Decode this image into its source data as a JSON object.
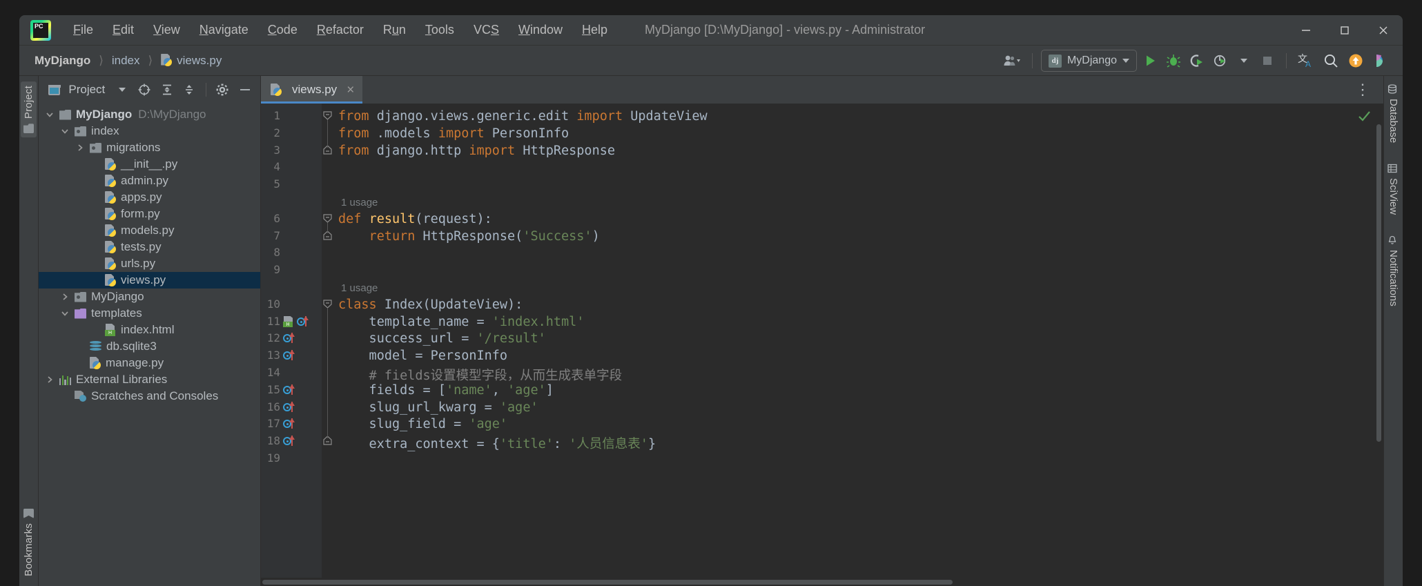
{
  "window": {
    "title": "MyDjango [D:\\MyDjango] - views.py - Administrator",
    "minimize": "minimize-icon",
    "maximize": "maximize-icon",
    "close": "close-icon"
  },
  "menu": [
    {
      "label": "File",
      "mnemonic": "F"
    },
    {
      "label": "Edit",
      "mnemonic": "E"
    },
    {
      "label": "View",
      "mnemonic": "V"
    },
    {
      "label": "Navigate",
      "mnemonic": "N"
    },
    {
      "label": "Code",
      "mnemonic": "C"
    },
    {
      "label": "Refactor",
      "mnemonic": "R"
    },
    {
      "label": "Run",
      "mnemonic": "u"
    },
    {
      "label": "Tools",
      "mnemonic": "T"
    },
    {
      "label": "VCS",
      "mnemonic": "S"
    },
    {
      "label": "Window",
      "mnemonic": "W"
    },
    {
      "label": "Help",
      "mnemonic": "H"
    }
  ],
  "breadcrumbs": [
    {
      "label": "MyDjango",
      "bold": true,
      "icon": ""
    },
    {
      "label": "index",
      "bold": false,
      "icon": ""
    },
    {
      "label": "views.py",
      "bold": false,
      "icon": "python-file-icon"
    }
  ],
  "toolbar": {
    "user_icon": "user-accounts-icon",
    "run_config": {
      "label": "MyDjango",
      "badge": "dj"
    },
    "run_icon": "run-icon",
    "debug_icon": "debug-icon",
    "run_coverage_icon": "run-with-coverage-icon",
    "profile_icon": "profiler-icon",
    "stop_icon": "stop-icon",
    "translate_icon": "translate-icon",
    "search_icon": "search-everywhere-icon",
    "update_icon": "update-project-icon",
    "ide_icon": "ide-feature-icon"
  },
  "left_tabs": [
    {
      "label": "Project",
      "icon": "project-folder-icon",
      "active": true
    },
    {
      "label": "Bookmarks",
      "icon": "bookmarks-icon",
      "active": false
    }
  ],
  "project_panel": {
    "title": "Project",
    "title_icon": "project-view-icon",
    "buttons": [
      {
        "name": "select-opened-file-icon"
      },
      {
        "name": "expand-all-icon"
      },
      {
        "name": "collapse-all-icon"
      },
      {
        "name": "settings-gear-icon"
      },
      {
        "name": "hide-panel-icon"
      }
    ],
    "tree": [
      {
        "label": "MyDjango",
        "hint": "D:\\MyDjango",
        "indent": 0,
        "arrow": "down",
        "icon": "folder",
        "bold": true,
        "selected": false
      },
      {
        "label": "index",
        "hint": "",
        "indent": 1,
        "arrow": "down",
        "icon": "package",
        "bold": false,
        "selected": false
      },
      {
        "label": "migrations",
        "hint": "",
        "indent": 2,
        "arrow": "right",
        "icon": "package",
        "bold": false,
        "selected": false
      },
      {
        "label": "__init__.py",
        "hint": "",
        "indent": 3,
        "arrow": "none",
        "icon": "python",
        "bold": false,
        "selected": false
      },
      {
        "label": "admin.py",
        "hint": "",
        "indent": 3,
        "arrow": "none",
        "icon": "python",
        "bold": false,
        "selected": false
      },
      {
        "label": "apps.py",
        "hint": "",
        "indent": 3,
        "arrow": "none",
        "icon": "python",
        "bold": false,
        "selected": false
      },
      {
        "label": "form.py",
        "hint": "",
        "indent": 3,
        "arrow": "none",
        "icon": "python",
        "bold": false,
        "selected": false
      },
      {
        "label": "models.py",
        "hint": "",
        "indent": 3,
        "arrow": "none",
        "icon": "python",
        "bold": false,
        "selected": false
      },
      {
        "label": "tests.py",
        "hint": "",
        "indent": 3,
        "arrow": "none",
        "icon": "python",
        "bold": false,
        "selected": false
      },
      {
        "label": "urls.py",
        "hint": "",
        "indent": 3,
        "arrow": "none",
        "icon": "python",
        "bold": false,
        "selected": false
      },
      {
        "label": "views.py",
        "hint": "",
        "indent": 3,
        "arrow": "none",
        "icon": "python",
        "bold": false,
        "selected": true
      },
      {
        "label": "MyDjango",
        "hint": "",
        "indent": 1,
        "arrow": "right",
        "icon": "package",
        "bold": false,
        "selected": false
      },
      {
        "label": "templates",
        "hint": "",
        "indent": 1,
        "arrow": "down",
        "icon": "folder-purple",
        "bold": false,
        "selected": false
      },
      {
        "label": "index.html",
        "hint": "",
        "indent": 3,
        "arrow": "none",
        "icon": "html",
        "bold": false,
        "selected": false
      },
      {
        "label": "db.sqlite3",
        "hint": "",
        "indent": 2,
        "arrow": "none",
        "icon": "database",
        "bold": false,
        "selected": false
      },
      {
        "label": "manage.py",
        "hint": "",
        "indent": 2,
        "arrow": "none",
        "icon": "python",
        "bold": false,
        "selected": false
      },
      {
        "label": "External Libraries",
        "hint": "",
        "indent": 0,
        "arrow": "right",
        "icon": "libraries",
        "bold": false,
        "selected": false
      },
      {
        "label": "Scratches and Consoles",
        "hint": "",
        "indent": 1,
        "arrow": "none",
        "icon": "scratches",
        "bold": false,
        "selected": false
      }
    ]
  },
  "editor": {
    "tab": {
      "label": "views.py",
      "icon": "python-file-icon",
      "close": "close-tab-icon"
    },
    "more_menu": "more-options-icon",
    "inspection_status": "no-problems-check-icon",
    "lines": [
      {
        "num": "1",
        "inlay": "",
        "gutter": [],
        "fold": "fold-start",
        "tokens": [
          {
            "t": "from ",
            "c": "k"
          },
          {
            "t": "django.views.generic.edit ",
            "c": "pl"
          },
          {
            "t": "import ",
            "c": "k"
          },
          {
            "t": "UpdateView",
            "c": "cls"
          }
        ]
      },
      {
        "num": "2",
        "inlay": "",
        "gutter": [],
        "fold": "",
        "tokens": [
          {
            "t": "from ",
            "c": "k"
          },
          {
            "t": ".models ",
            "c": "pl"
          },
          {
            "t": "import ",
            "c": "k"
          },
          {
            "t": "PersonInfo",
            "c": "cls"
          }
        ]
      },
      {
        "num": "3",
        "inlay": "",
        "gutter": [],
        "fold": "fold-end",
        "tokens": [
          {
            "t": "from ",
            "c": "k"
          },
          {
            "t": "django.http ",
            "c": "pl"
          },
          {
            "t": "import ",
            "c": "k"
          },
          {
            "t": "HttpResponse",
            "c": "cls"
          }
        ]
      },
      {
        "num": "4",
        "inlay": "",
        "gutter": [],
        "fold": "",
        "tokens": []
      },
      {
        "num": "5",
        "inlay": "",
        "gutter": [],
        "fold": "",
        "tokens": []
      },
      {
        "num": "",
        "inlay": "1 usage",
        "gutter": [],
        "fold": "",
        "tokens": []
      },
      {
        "num": "6",
        "inlay": "",
        "gutter": [],
        "fold": "fold-start",
        "tokens": [
          {
            "t": "def ",
            "c": "k"
          },
          {
            "t": "result",
            "c": "fn"
          },
          {
            "t": "(request):",
            "c": "pl"
          }
        ]
      },
      {
        "num": "7",
        "inlay": "",
        "gutter": [],
        "fold": "fold-end",
        "tokens": [
          {
            "t": "    return ",
            "c": "k"
          },
          {
            "t": "HttpResponse(",
            "c": "cls"
          },
          {
            "t": "'Success'",
            "c": "s"
          },
          {
            "t": ")",
            "c": "pl"
          }
        ]
      },
      {
        "num": "8",
        "inlay": "",
        "gutter": [],
        "fold": "",
        "tokens": []
      },
      {
        "num": "9",
        "inlay": "",
        "gutter": [],
        "fold": "",
        "tokens": []
      },
      {
        "num": "",
        "inlay": "1 usage",
        "gutter": [],
        "fold": "",
        "tokens": []
      },
      {
        "num": "10",
        "inlay": "",
        "gutter": [],
        "fold": "fold-start",
        "tokens": [
          {
            "t": "class ",
            "c": "k"
          },
          {
            "t": "Index(UpdateView):",
            "c": "cls"
          }
        ]
      },
      {
        "num": "11",
        "inlay": "",
        "gutter": [
          "html-file-icon",
          "overridden-member-icon"
        ],
        "fold": "",
        "tokens": [
          {
            "t": "    template_name = ",
            "c": "pl"
          },
          {
            "t": "'index.html'",
            "c": "s"
          }
        ]
      },
      {
        "num": "12",
        "inlay": "",
        "gutter": [
          "overridden-member-icon"
        ],
        "fold": "",
        "tokens": [
          {
            "t": "    success_url = ",
            "c": "pl"
          },
          {
            "t": "'/result'",
            "c": "s"
          }
        ]
      },
      {
        "num": "13",
        "inlay": "",
        "gutter": [
          "overridden-member-icon"
        ],
        "fold": "",
        "tokens": [
          {
            "t": "    model = PersonInfo",
            "c": "pl"
          }
        ]
      },
      {
        "num": "14",
        "inlay": "",
        "gutter": [],
        "fold": "",
        "tokens": [
          {
            "t": "    # fields设置模型字段，从而生成表单字段",
            "c": "cm"
          }
        ]
      },
      {
        "num": "15",
        "inlay": "",
        "gutter": [
          "overridden-member-icon"
        ],
        "fold": "",
        "tokens": [
          {
            "t": "    fields = [",
            "c": "pl"
          },
          {
            "t": "'name'",
            "c": "s"
          },
          {
            "t": ", ",
            "c": "pl"
          },
          {
            "t": "'age'",
            "c": "s"
          },
          {
            "t": "]",
            "c": "pl"
          }
        ]
      },
      {
        "num": "16",
        "inlay": "",
        "gutter": [
          "overridden-member-icon"
        ],
        "fold": "",
        "tokens": [
          {
            "t": "    slug_url_kwarg = ",
            "c": "pl"
          },
          {
            "t": "'age'",
            "c": "s"
          }
        ]
      },
      {
        "num": "17",
        "inlay": "",
        "gutter": [
          "overridden-member-icon"
        ],
        "fold": "",
        "tokens": [
          {
            "t": "    slug_field = ",
            "c": "pl"
          },
          {
            "t": "'age'",
            "c": "s"
          }
        ]
      },
      {
        "num": "18",
        "inlay": "",
        "gutter": [
          "overridden-member-icon"
        ],
        "fold": "fold-end",
        "tokens": [
          {
            "t": "    extra_context = {",
            "c": "pl"
          },
          {
            "t": "'title'",
            "c": "s"
          },
          {
            "t": ": ",
            "c": "pl"
          },
          {
            "t": "'人员信息表'",
            "c": "s"
          },
          {
            "t": "}",
            "c": "pl"
          }
        ]
      },
      {
        "num": "19",
        "inlay": "",
        "gutter": [],
        "fold": "",
        "tokens": []
      }
    ]
  },
  "right_tabs": [
    {
      "label": "Database",
      "icon": "database-tool-icon"
    },
    {
      "label": "SciView",
      "icon": "sciview-icon"
    },
    {
      "label": "Notifications",
      "icon": "notifications-bell-icon"
    }
  ]
}
